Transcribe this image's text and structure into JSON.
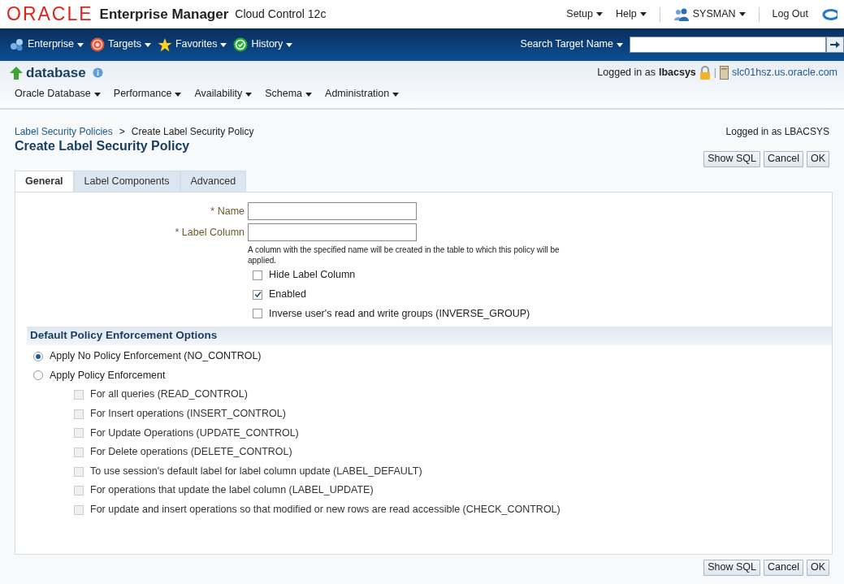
{
  "header": {
    "brand": "ORACLE",
    "product": "Enterprise Manager",
    "edition": "Cloud Control 12c",
    "menus": [
      "Setup",
      "Help"
    ],
    "user": "SYSMAN",
    "logout": "Log Out"
  },
  "nav": {
    "items": [
      "Enterprise",
      "Targets",
      "Favorites",
      "History"
    ],
    "search_label": "Search Target Name"
  },
  "target": {
    "name": "database",
    "logged_prefix": "Logged in as",
    "user": "lbacsys",
    "separator": "|",
    "host": "slc01hsz.us.oracle.com",
    "menus": [
      "Oracle Database",
      "Performance",
      "Availability",
      "Schema",
      "Administration"
    ]
  },
  "breadcrumb": {
    "link": "Label Security Policies",
    "separator": ">",
    "current": "Create Label Security Policy"
  },
  "page": {
    "title": "Create Label Security Policy",
    "logged_in": "Logged in as LBACSYS",
    "buttons": [
      "Show SQL",
      "Cancel",
      "OK"
    ]
  },
  "tabs": [
    {
      "label": "General",
      "selected": true
    },
    {
      "label": "Label Components",
      "selected": false
    },
    {
      "label": "Advanced",
      "selected": false
    }
  ],
  "fields": [
    {
      "mark": "*",
      "label": "Name"
    },
    {
      "mark": "*",
      "label": "Label Column",
      "hint": "A column with the specified name will be created in the table to which this policy will be applied."
    }
  ],
  "checkboxes": [
    {
      "label": "Hide Label Column",
      "checked": false
    },
    {
      "label": "Enabled",
      "checked": true
    },
    {
      "label": "Inverse user's read and write groups (INVERSE_GROUP)",
      "checked": false
    }
  ],
  "enforcement": {
    "title": "Default Policy Enforcement Options",
    "radios": [
      {
        "label": "Apply No Policy Enforcement (NO_CONTROL)",
        "selected": true
      },
      {
        "label": "Apply Policy Enforcement",
        "selected": false
      }
    ],
    "options": [
      {
        "label": "For all queries (READ_CONTROL)",
        "checked": false,
        "disabled": true
      },
      {
        "label": "For Insert operations (INSERT_CONTROL)",
        "checked": false,
        "disabled": true
      },
      {
        "label": "For Update Operations (UPDATE_CONTROL)",
        "checked": false,
        "disabled": true
      },
      {
        "label": "For Delete operations (DELETE_CONTROL)",
        "checked": false,
        "disabled": true
      },
      {
        "label": "To use session's default label for label column update (LABEL_DEFAULT)",
        "checked": false,
        "disabled": true
      },
      {
        "label": "For operations that update the label column (LABEL_UPDATE)",
        "checked": false,
        "disabled": true
      },
      {
        "label": "For update and insert operations so that modified or new rows are read accessible (CHECK_CONTROL)",
        "checked": false,
        "disabled": true
      }
    ]
  },
  "footer_buttons": [
    "Show SQL",
    "Cancel",
    "OK"
  ]
}
